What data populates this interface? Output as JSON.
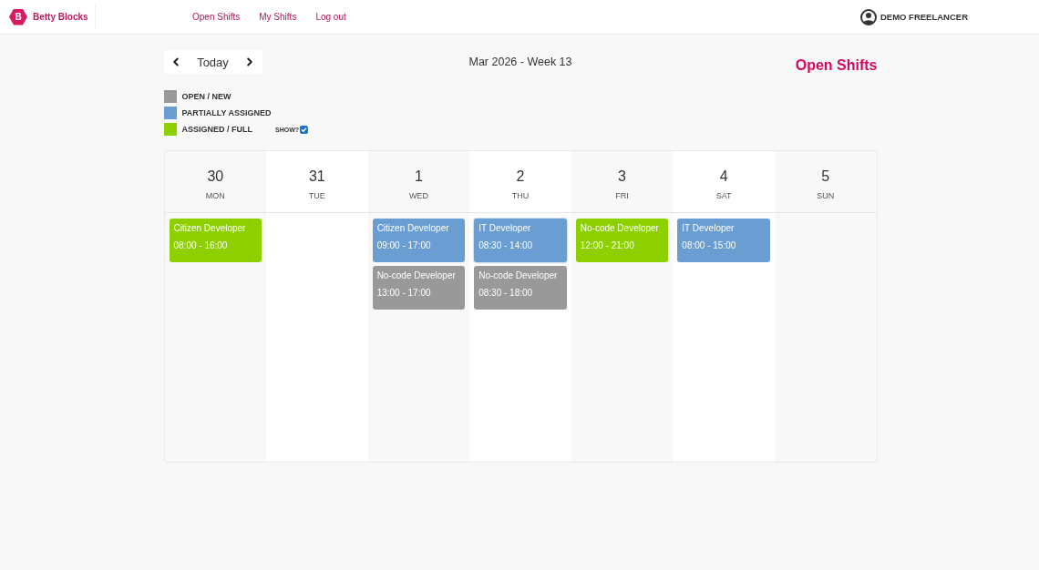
{
  "header": {
    "logo": {
      "mark": "B",
      "name": "Betty Blocks"
    },
    "nav": [
      {
        "label": "Open Shifts"
      },
      {
        "label": "My Shifts"
      },
      {
        "label": "Log out"
      }
    ],
    "user": {
      "name": "DEMO FREELANCER"
    }
  },
  "toolbar": {
    "today_button": "Today",
    "period": "Mar 2026 - Week 13",
    "page_title": "Open Shifts"
  },
  "legend": {
    "items": [
      {
        "label": "OPEN / NEW",
        "color": "#999999"
      },
      {
        "label": "PARTIALLY ASSIGNED",
        "color": "#6a9dd1"
      },
      {
        "label": "ASSIGNED / FULL",
        "color": "#8ecf00",
        "toggle": {
          "label": "SHOW?",
          "checked": true
        }
      }
    ]
  },
  "calendar": {
    "days": [
      {
        "date": "30",
        "weekday": "MON",
        "shifts": [
          {
            "title": "Citizen Developer",
            "time": "08:00 - 16:00",
            "color": "#8ecf00",
            "selected": false
          }
        ]
      },
      {
        "date": "31",
        "weekday": "TUE"
      },
      {
        "date": "1",
        "weekday": "WED",
        "shifts": [
          {
            "title": "Citizen Developer",
            "time": "09:00 - 17:00",
            "color": "#6a9dd1",
            "selected": false
          },
          {
            "title": "No-code Developer",
            "time": "13:00 - 17:00",
            "color": "#999999",
            "selected": false
          }
        ]
      },
      {
        "date": "2",
        "weekday": "THU",
        "shifts": [
          {
            "title": "IT Developer",
            "time": "08:30 - 14:00",
            "color": "#6a9dd1",
            "selected": true
          },
          {
            "title": "No-code Developer",
            "time": "08:30 - 18:00",
            "color": "#999999",
            "selected": false
          }
        ]
      },
      {
        "date": "3",
        "weekday": "FRI",
        "shifts": [
          {
            "title": "No-code Developer",
            "time": "12:00 - 21:00",
            "color": "#8ecf00",
            "selected": false
          }
        ]
      },
      {
        "date": "4",
        "weekday": "SAT",
        "shifts": [
          {
            "title": "IT Developer",
            "time": "08:00 - 15:00",
            "color": "#6a9dd1",
            "selected": false
          }
        ]
      },
      {
        "date": "5",
        "weekday": "SUN"
      }
    ]
  }
}
